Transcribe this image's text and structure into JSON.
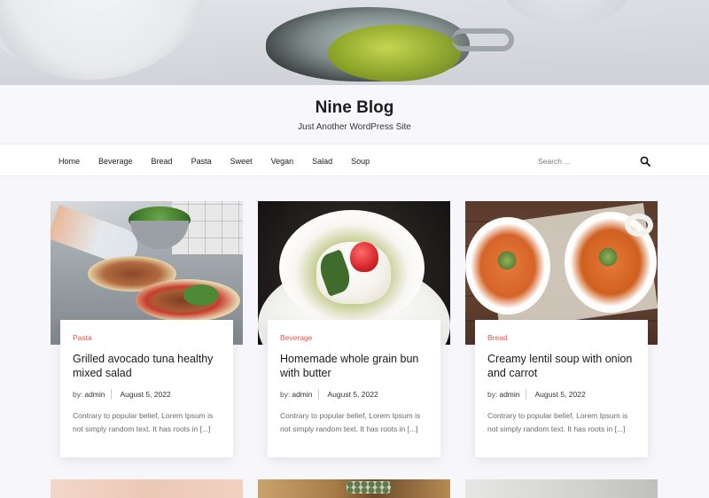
{
  "site": {
    "title": "Nine Blog",
    "tagline": "Just Another WordPress Site"
  },
  "nav": {
    "items": [
      {
        "label": "Home"
      },
      {
        "label": "Beverage"
      },
      {
        "label": "Bread"
      },
      {
        "label": "Pasta"
      },
      {
        "label": "Sweet"
      },
      {
        "label": "Vegan"
      },
      {
        "label": "Salad"
      },
      {
        "label": "Soup"
      }
    ],
    "search": {
      "placeholder": "Search ...",
      "value": "",
      "icon": "search-icon"
    }
  },
  "posts": [
    {
      "category": "Pasta",
      "title": "Grilled avocado tuna healthy mixed salad",
      "by_label": "by:",
      "author": "admin",
      "date": "August 5, 2022",
      "excerpt": "Contrary to popular belief, Lorem Ipsum is not simply random text. It has roots in [...]"
    },
    {
      "category": "Beverage",
      "title": "Homemade whole grain bun with butter",
      "by_label": "by:",
      "author": "admin",
      "date": "August 5, 2022",
      "excerpt": "Contrary to popular belief, Lorem Ipsum is not simply random text. It has roots in [...]"
    },
    {
      "category": "Bread",
      "title": "Creamy lentil soup with onion and carrot",
      "by_label": "by:",
      "author": "admin",
      "date": "August 5, 2022",
      "excerpt": "Contrary to popular belief, Lorem Ipsum is not simply random text. It has roots in [...]"
    }
  ],
  "colors": {
    "category_accent": "#e3564b",
    "page_background": "#f6f6fb",
    "card_background": "#ffffff"
  }
}
